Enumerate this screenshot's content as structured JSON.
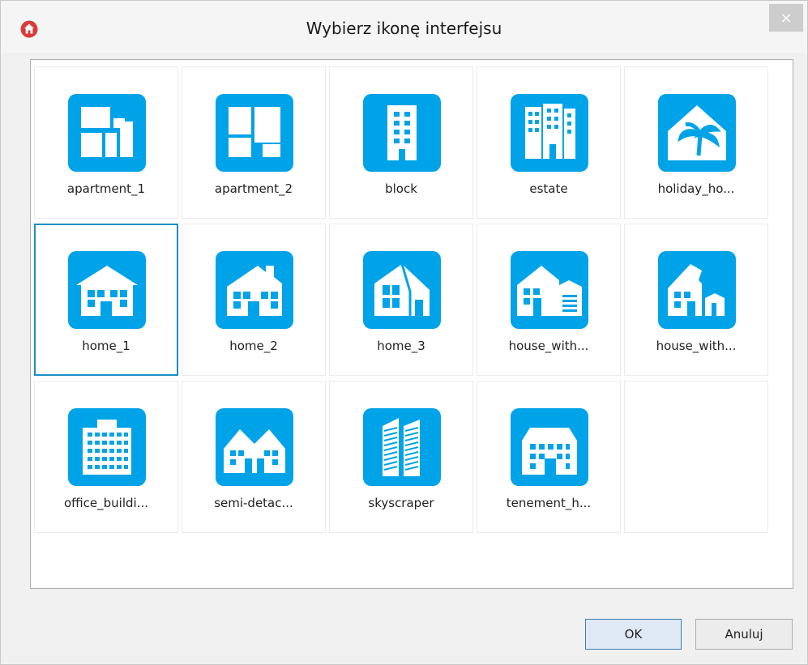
{
  "dialog": {
    "title": "Wybierz ikonę interfejsu",
    "close_symbol": "×",
    "app_icon": "home-logo-icon",
    "accent_color": "#00a3e8"
  },
  "icons": [
    {
      "label": "apartment_1",
      "icon": "apartment-1-icon",
      "selected": false
    },
    {
      "label": "apartment_2",
      "icon": "apartment-2-icon",
      "selected": false
    },
    {
      "label": "block",
      "icon": "block-icon",
      "selected": false
    },
    {
      "label": "estate",
      "icon": "estate-icon",
      "selected": false
    },
    {
      "label": "holiday_ho...",
      "icon": "holiday-house-icon",
      "selected": false
    },
    {
      "label": "home_1",
      "icon": "home-1-icon",
      "selected": true
    },
    {
      "label": "home_2",
      "icon": "home-2-icon",
      "selected": false
    },
    {
      "label": "home_3",
      "icon": "home-3-icon",
      "selected": false
    },
    {
      "label": "house_with...",
      "icon": "house-with-garage-icon",
      "selected": false
    },
    {
      "label": "house_with...",
      "icon": "house-with-annex-icon",
      "selected": false
    },
    {
      "label": "office_buildi...",
      "icon": "office-building-icon",
      "selected": false
    },
    {
      "label": "semi-detac...",
      "icon": "semi-detached-icon",
      "selected": false
    },
    {
      "label": "skyscraper",
      "icon": "skyscraper-icon",
      "selected": false
    },
    {
      "label": "tenement_h...",
      "icon": "tenement-house-icon",
      "selected": false
    }
  ],
  "buttons": {
    "ok_label": "OK",
    "cancel_label": "Anuluj"
  }
}
